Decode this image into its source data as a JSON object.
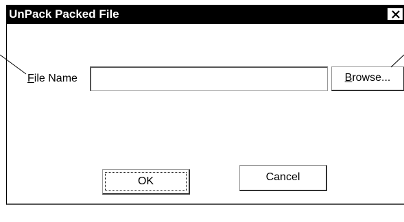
{
  "window": {
    "title": "UnPack Packed File",
    "close_icon": "close-icon"
  },
  "form": {
    "file_name_label_mnemonic": "F",
    "file_name_label_rest": "ile Name",
    "file_name_value": "",
    "browse_label_mnemonic": "B",
    "browse_label_rest": "rowse..."
  },
  "buttons": {
    "ok_label": "OK",
    "cancel_label": "Cancel"
  }
}
